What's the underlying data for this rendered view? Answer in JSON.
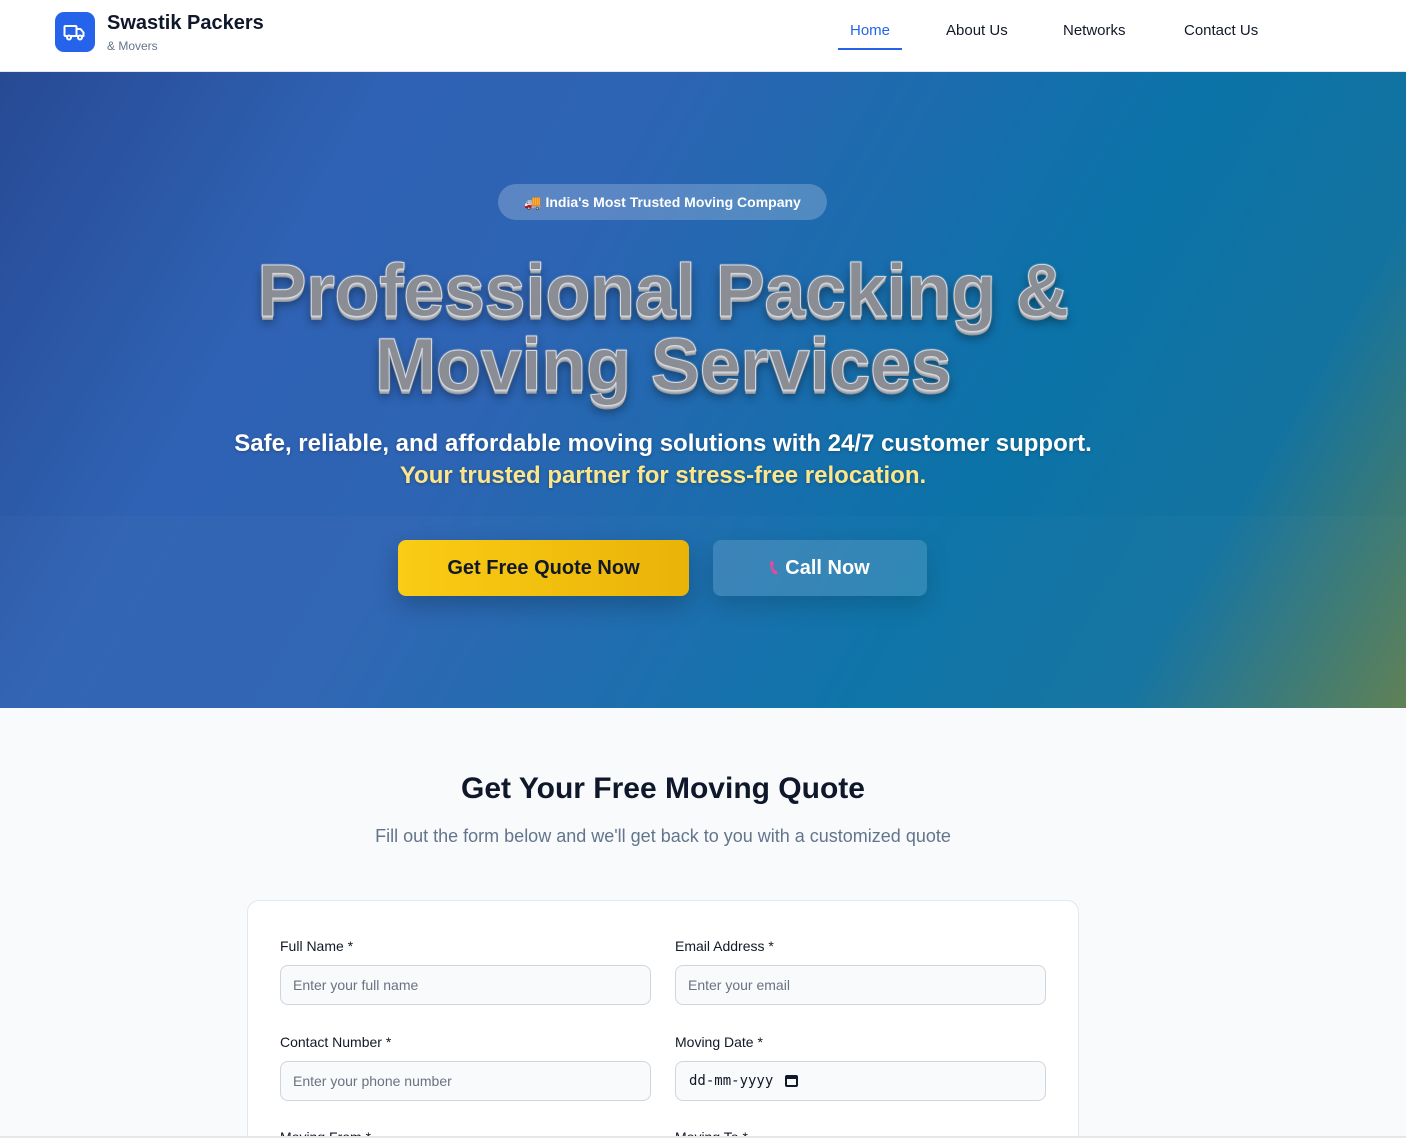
{
  "brand": {
    "name": "Swastik Packers",
    "sub": "& Movers",
    "logo_icon": "truck-icon",
    "accent": "#2563eb"
  },
  "nav": {
    "items": [
      {
        "label": "Home",
        "active": true
      },
      {
        "label": "About Us",
        "active": false
      },
      {
        "label": "Networks",
        "active": false
      },
      {
        "label": "Contact Us",
        "active": false
      }
    ]
  },
  "hero": {
    "badge_icon": "truck-emoji",
    "badge": "🚚 India's Most Trusted Moving Company",
    "title_line1": "Professional Packing &",
    "title_line2": "Moving Services",
    "subtitle_line1": "Safe, reliable, and affordable moving solutions with 24/7 customer support.",
    "subtitle_line2": "Your trusted partner for stress-free relocation.",
    "cta_primary": "Get Free Quote Now",
    "cta_secondary": "Call Now",
    "cta_secondary_icon": "phone-icon",
    "highlight_color": "#fde68a",
    "button_color": "#facc15"
  },
  "quote": {
    "title": "Get Your Free Moving Quote",
    "subtitle": "Fill out the form below and we'll get back to you with a customized quote",
    "fields": {
      "full_name": {
        "label": "Full Name *",
        "placeholder": "Enter your full name"
      },
      "email": {
        "label": "Email Address *",
        "placeholder": "Enter your email"
      },
      "contact": {
        "label": "Contact Number *",
        "placeholder": "Enter your phone number"
      },
      "moving_date": {
        "label": "Moving Date *",
        "value": "dd-mm-yyyy"
      },
      "moving_from": {
        "label": "Moving From *"
      },
      "moving_to": {
        "label": "Moving To *"
      }
    }
  }
}
